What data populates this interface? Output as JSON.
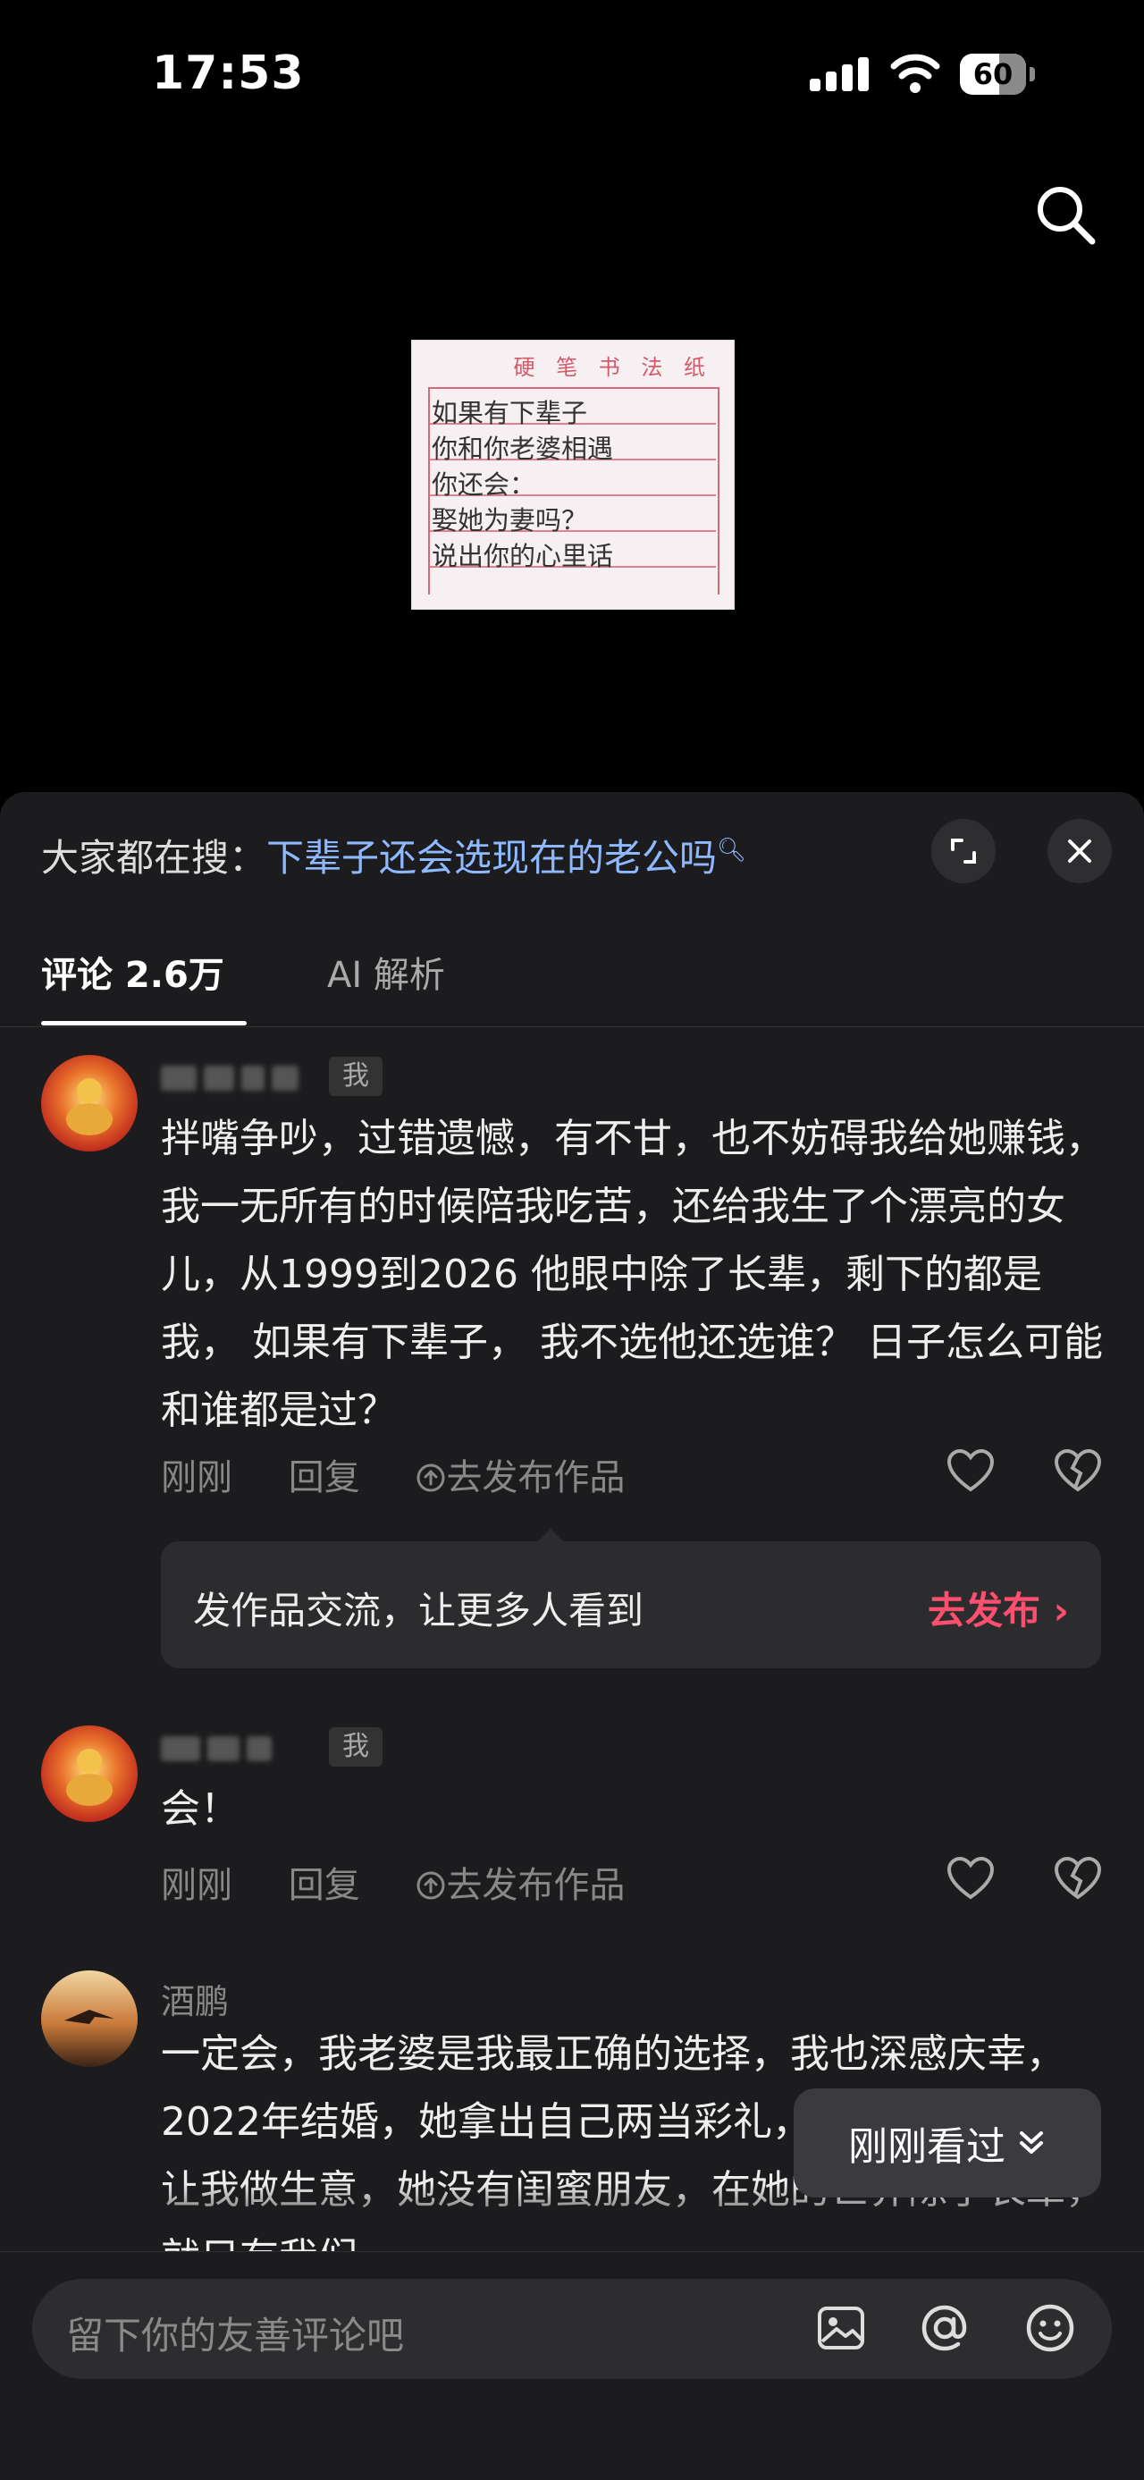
{
  "status": {
    "time": "17:53",
    "battery": "60",
    "battery_level": 0.6
  },
  "post_image": {
    "paper_title": "硬 笔 书 法 纸",
    "lines": [
      "如果有下辈子",
      "你和你老婆相遇",
      "你还会：",
      "娶她为妻吗？",
      "说出你的心里话"
    ]
  },
  "panel": {
    "hot_search_prefix": "大家都在搜：",
    "hot_search_query": "下辈子还会选现在的老公吗",
    "tabs": [
      {
        "label": "评论 2.6万"
      },
      {
        "label": "AI 解析"
      }
    ]
  },
  "comments": [
    {
      "name": "",
      "tag": "我",
      "text": "拌嘴争吵，过错遗憾，有不甘，也不妨碍我给她赚钱，我一无所有的时候陪我吃苦，还给我生了个漂亮的女儿，从1999到2026  他眼中除了长辈，剩下的都是我，  如果有下辈子，  我不选他还选谁？  日子怎么可能和谁都是过？",
      "time": "刚刚",
      "reply": "回复",
      "publish": "去发布作品"
    },
    {
      "name": "",
      "tag": "我",
      "text": "会！",
      "time": "刚刚",
      "reply": "回复",
      "publish": "去发布作品"
    },
    {
      "name": "酒鹏",
      "text": "一定会，我老婆是我最正确的选择，我也深感庆幸，2022年结婚，她拿出自己两当彩礼，婚后又给我贷款让我做生意，她没有闺蜜朋友，在她的世界除了长辈，就只有我们"
    }
  ],
  "promo": {
    "text": "发作品交流，让更多人看到",
    "button": "去发布"
  },
  "recently_viewed": {
    "label": "刚刚看过"
  },
  "input": {
    "placeholder": "留下你的友善评论吧"
  }
}
